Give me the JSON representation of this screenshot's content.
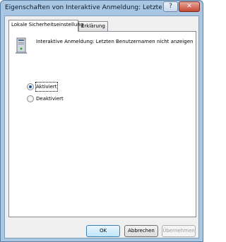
{
  "window": {
    "title": "Eigenschaften von Interaktive Anmeldung: Letzten Benutzerna...",
    "help_label": "?",
    "close_label": "✕"
  },
  "tabs": [
    {
      "label": "Lokale Sicherheitseinstellung",
      "active": true
    },
    {
      "label": "Erklärung",
      "active": false
    }
  ],
  "policy": {
    "icon": "computer-policy-icon",
    "text": "Interaktive Anmeldung: Letzten Benutzernamen nicht anzeigen"
  },
  "options": [
    {
      "label": "Aktiviert",
      "selected": true
    },
    {
      "label": "Deaktiviert",
      "selected": false
    }
  ],
  "buttons": {
    "ok": "OK",
    "cancel": "Abbrechen",
    "apply": "Übernehmen"
  },
  "colors": {
    "frame": "#a9c7e3",
    "close_button": "#c34733",
    "radio_dot": "#1e4f9c"
  }
}
